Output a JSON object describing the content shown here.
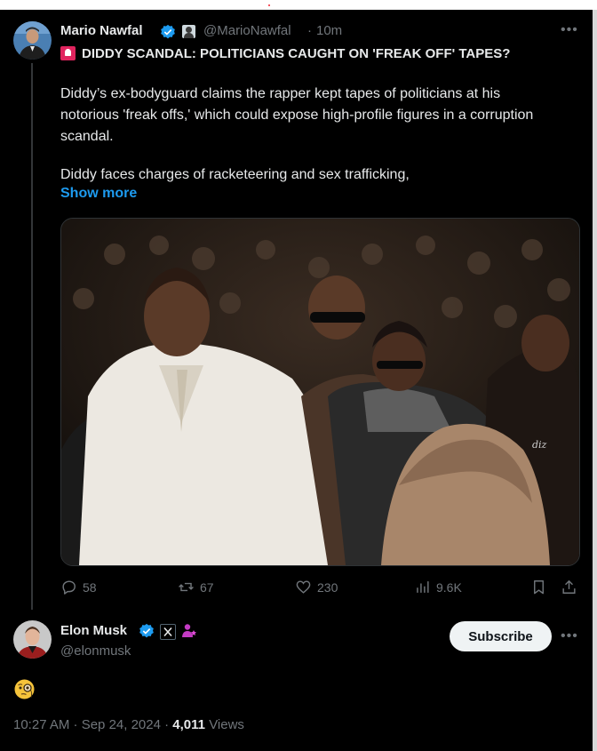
{
  "tweet": {
    "author_name": "Mario Nawfal",
    "author_handle": "@MarioNawfal",
    "separator": "·",
    "time_ago": "10m",
    "headline": "DIDDY SCANDAL: POLITICIANS CAUGHT ON 'FREAK OFF' TAPES?",
    "paragraph1": "Diddy’s ex-bodyguard claims the rapper kept tapes of politicians at his notorious 'freak offs,' which could expose high-profile figures in a corruption scandal.",
    "paragraph2": "Diddy faces charges of racketeering and sex trafficking,",
    "show_more": "Show more",
    "stats": {
      "replies": "58",
      "reposts": "67",
      "likes": "230",
      "views": "9.6K"
    }
  },
  "reply": {
    "author_name": "Elon Musk",
    "author_handle": "@elonmusk",
    "subscribe_label": "Subscribe",
    "emoji": "monocle-face",
    "timestamp": "10:27 AM · Sep 24, 2024 ·",
    "views_count": "4,011",
    "views_label": "Views"
  },
  "colors": {
    "background": "#000000",
    "text": "#e7e9ea",
    "muted": "#71767b",
    "link": "#1d9bf0",
    "verified": "#1d9bf0",
    "subscribe_bg": "#eff3f4"
  },
  "icons": {
    "more": "more-horizontal-icon",
    "reply": "reply-icon",
    "repost": "repost-icon",
    "like": "heart-icon",
    "views": "analytics-icon",
    "bookmark": "bookmark-icon",
    "share": "share-icon"
  }
}
